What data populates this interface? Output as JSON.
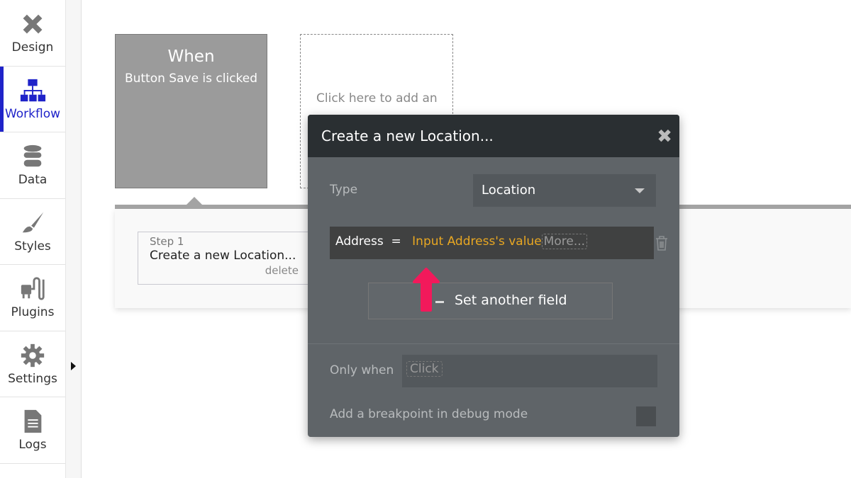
{
  "sidebar": {
    "items": [
      {
        "label": "Design",
        "icon": "design-tools-icon"
      },
      {
        "label": "Workflow",
        "icon": "workflow-icon",
        "active": true
      },
      {
        "label": "Data",
        "icon": "database-icon"
      },
      {
        "label": "Styles",
        "icon": "brush-icon"
      },
      {
        "label": "Plugins",
        "icon": "plug-icon"
      },
      {
        "label": "Settings",
        "icon": "gear-icon"
      },
      {
        "label": "Logs",
        "icon": "document-icon"
      }
    ]
  },
  "canvas": {
    "event": {
      "title": "When",
      "subtitle": "Button Save is clicked"
    },
    "add_event": "Click here to add an",
    "step": {
      "number": "Step 1",
      "title": "Create a new Location...",
      "delete": "delete"
    }
  },
  "modal": {
    "title": "Create a new Location...",
    "type_label": "Type",
    "type_value": "Location",
    "field": {
      "name": "Address",
      "op": "=",
      "value": "Input Address's value",
      "more": "More..."
    },
    "set_another": "Set another field",
    "only_when_label": "Only when",
    "only_when_placeholder": "Click",
    "breakpoint_label": "Add a breakpoint in debug mode"
  },
  "colors": {
    "accent": "#1f23c9",
    "dynamic_value": "#e8a722",
    "annotation_arrow": "#f2195b"
  }
}
